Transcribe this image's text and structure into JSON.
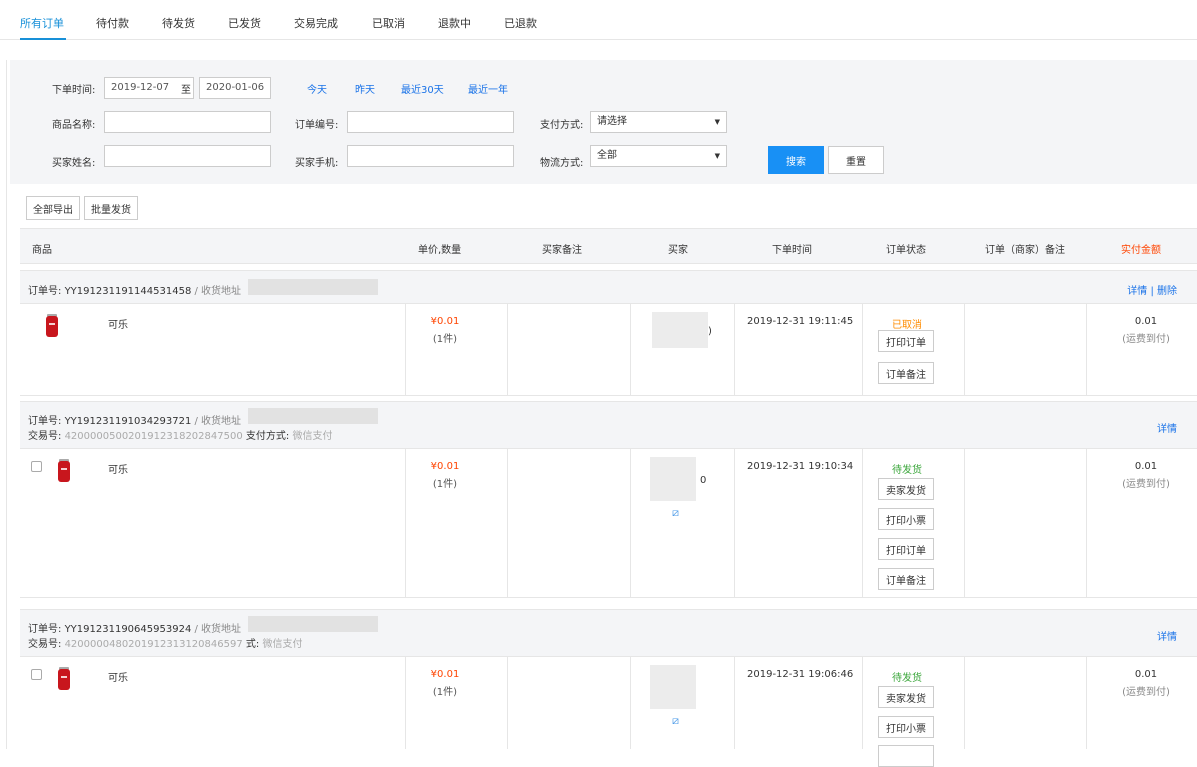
{
  "tabs": [
    "所有订单",
    "待付款",
    "待发货",
    "已发货",
    "交易完成",
    "已取消",
    "退款中",
    "已退款"
  ],
  "filter": {
    "order_time_label": "下单时间:",
    "date_from": "2019-12-07",
    "date_to_sep": "至",
    "date_to": "2020-01-06",
    "quick": [
      "今天",
      "昨天",
      "最近30天",
      "最近一年"
    ],
    "product_name_label": "商品名称:",
    "order_no_label": "订单编号:",
    "pay_method_label": "支付方式:",
    "pay_method_value": "请选择",
    "buyer_name_label": "买家姓名:",
    "buyer_phone_label": "买家手机:",
    "logistics_label": "物流方式:",
    "logistics_value": "全部",
    "search_btn": "搜索",
    "reset_btn": "重置"
  },
  "toolbar": {
    "export_all": "全部导出",
    "batch_ship": "批量发货"
  },
  "columns": [
    "商品",
    "单价,数量",
    "买家备注",
    "买家",
    "下单时间",
    "订单状态",
    "订单（商家）备注",
    "实付金额"
  ],
  "colors": {
    "accent": "#1890d8",
    "price_red": "#ff4400",
    "cancelled_orange": "#ff8c00",
    "pending_green": "#3aa63a"
  },
  "orders": [
    {
      "order_no_label": "订单号:",
      "order_no": "YY191231191144531458",
      "addr_label": "/ 收货地址",
      "actions": [
        "详情",
        "删除"
      ],
      "action_sep": "|",
      "product": "可乐",
      "price": "¥0.01",
      "qty": "(1件)",
      "buyer_suffix": ")",
      "time": "2019-12-31 19:11:45",
      "status": "已取消",
      "buttons": [
        "打印订单",
        "订单备注"
      ],
      "amount": "0.01",
      "amount_note": "(运费到付)"
    },
    {
      "order_no_label": "订单号:",
      "order_no": "YY191231191034293721",
      "addr_label": "/ 收货地址",
      "trade_no_label": "交易号:",
      "trade_no": "4200000500201912318202847500",
      "pay_label": "支付方式:",
      "pay_value": "微信支付",
      "actions": [
        "详情"
      ],
      "product": "可乐",
      "price": "¥0.01",
      "qty": "(1件)",
      "buyer_suffix": "0",
      "time": "2019-12-31 19:10:34",
      "status": "待发货",
      "buttons": [
        "卖家发货",
        "打印小票",
        "打印订单",
        "订单备注"
      ],
      "amount": "0.01",
      "amount_note": "(运费到付)"
    },
    {
      "order_no_label": "订单号:",
      "order_no": "YY191231190645953924",
      "addr_label": "/ 收货地址",
      "trade_no_label": "交易号:",
      "trade_no": "4200000480201912313120846597",
      "pay_label": "式:",
      "pay_value": "微信支付",
      "actions": [
        "详情"
      ],
      "product": "可乐",
      "price": "¥0.01",
      "qty": "(1件)",
      "time": "2019-12-31 19:06:46",
      "status": "待发货",
      "buttons": [
        "卖家发货",
        "打印小票"
      ],
      "amount": "0.01",
      "amount_note": "(运费到付)"
    }
  ]
}
